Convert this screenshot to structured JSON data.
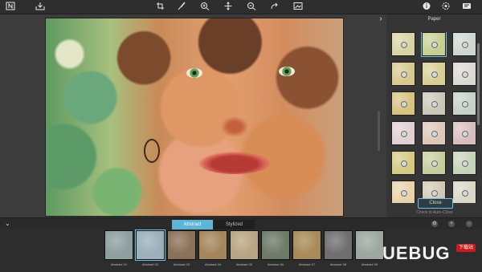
{
  "toolbar": {
    "icons": [
      "square-n-icon",
      "save-tray-icon",
      "crop-icon",
      "brush-icon",
      "zoom-in-icon",
      "move-icon",
      "zoom-out-icon",
      "redo-icon",
      "compare-icon",
      "info-icon",
      "settings-icon",
      "share-icon"
    ]
  },
  "panel": {
    "title": "Paper",
    "close_label": "Close",
    "autoclose_label": "Check to Auto-Close",
    "papers": [
      "#d8d4a4",
      "#c7cf8f",
      "#cfd7d2",
      "#d5c98d",
      "#d7cf93",
      "#dad9d4",
      "#d7c27f",
      "#c9c7b7",
      "#c6d2c5",
      "#e1cfd4",
      "#ddc7b7",
      "#d8bebf",
      "#d2cb80",
      "#c6ce9c",
      "#c6d3b7",
      "#e8d2aa",
      "#d3c8b3",
      "#d8d7c8"
    ]
  },
  "tabs": {
    "active": "Abstract",
    "inactive": "Stylized"
  },
  "filmstrip": {
    "items": [
      {
        "label": "Abstract 01",
        "color": "#8d9f9f"
      },
      {
        "label": "Abstract 02",
        "color": "#9cb0bb"
      },
      {
        "label": "Abstract 03",
        "color": "#8a7158"
      },
      {
        "label": "Abstract 04",
        "color": "#a5865b"
      },
      {
        "label": "Abstract 05",
        "color": "#b9a583"
      },
      {
        "label": "Abstract 06",
        "color": "#6e7a6a"
      },
      {
        "label": "Abstract 07",
        "color": "#a88b58"
      },
      {
        "label": "Abstract 08",
        "color": "#6f6f6f"
      },
      {
        "label": "Abstract 09",
        "color": "#9da7a0"
      }
    ]
  },
  "watermark": {
    "text": "UEBUG",
    "badge": "下载站"
  }
}
